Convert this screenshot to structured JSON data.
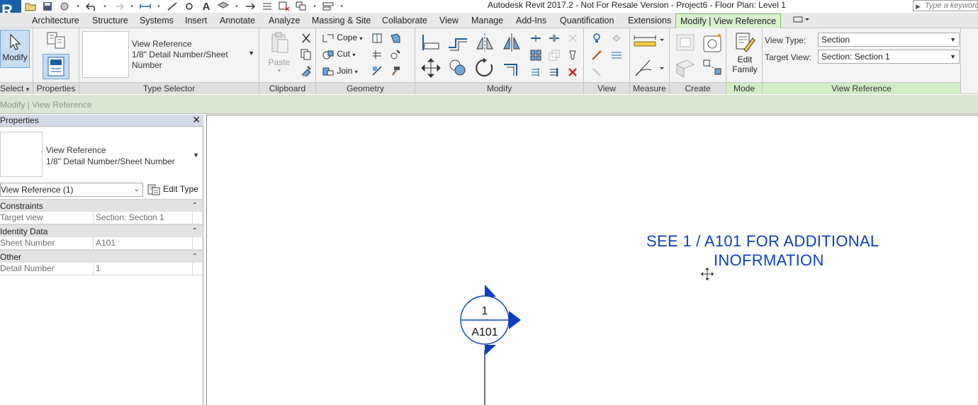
{
  "app": {
    "logo_letter": "R",
    "window_title": "Autodesk Revit 2017.2 - Not For Resale Version -     Project6 - Floor Plan: Level 1",
    "search_placeholder": "Type a keyword"
  },
  "tabs": [
    "Architecture",
    "Structure",
    "Systems",
    "Insert",
    "Annotate",
    "Analyze",
    "Massing & Site",
    "Collaborate",
    "View",
    "Manage",
    "Add-Ins",
    "Quantification",
    "Extensions",
    "Modify | View Reference"
  ],
  "ribbon": {
    "select": {
      "modify_label": "Modify",
      "panel_title": "Select"
    },
    "properties": {
      "panel_title": "Properties"
    },
    "type_selector": {
      "family_name": "View Reference",
      "type_name": "1/8\" Detail Number/Sheet Number",
      "panel_title": "Type Selector"
    },
    "clipboard": {
      "paste_label": "Paste",
      "panel_title": "Clipboard"
    },
    "geometry": {
      "cope_label": "Cope",
      "cut_label": "Cut",
      "join_label": "Join",
      "panel_title": "Geometry"
    },
    "modify": {
      "panel_title": "Modify"
    },
    "view": {
      "panel_title": "View"
    },
    "measure": {
      "panel_title": "Measure"
    },
    "create": {
      "panel_title": "Create"
    },
    "mode": {
      "edit_family_label": "Edit Family",
      "panel_title": "Mode"
    },
    "view_reference": {
      "view_type_label": "View Type:",
      "view_type_value": "Section",
      "target_view_label": "Target View:",
      "target_view_value": "Section: Section 1",
      "panel_title": "View Reference"
    }
  },
  "options_bar": {
    "label": "Modify | View Reference"
  },
  "properties_palette": {
    "title": "Properties",
    "family_name": "View Reference",
    "type_name": "1/8\" Detail Number/Sheet Number",
    "instance_filter": "View Reference (1)",
    "edit_type_label": "Edit Type",
    "groups": [
      {
        "name": "Constraints",
        "rows": [
          {
            "key": "Target view",
            "value": "Section: Section 1"
          }
        ]
      },
      {
        "name": "Identity Data",
        "rows": [
          {
            "key": "Sheet Number",
            "value": "A101"
          }
        ]
      },
      {
        "name": "Other",
        "rows": [
          {
            "key": "Detail Number",
            "value": "1"
          }
        ]
      }
    ]
  },
  "canvas": {
    "note_line1": "SEE 1 / A101 FOR ADDITIONAL",
    "note_line2": "INOFRMATION",
    "view_ref_detail_number": "1",
    "view_ref_sheet_number": "A101",
    "annotation_color": "#0b3fbf"
  }
}
